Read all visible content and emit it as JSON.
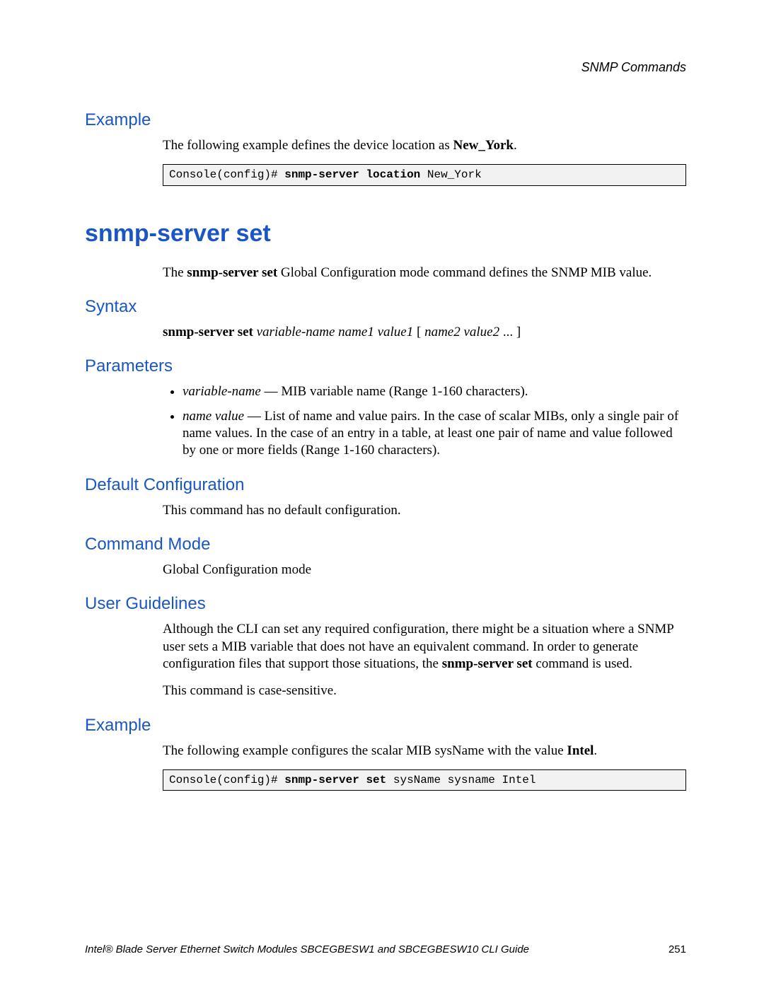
{
  "header": {
    "chapter": "SNMP Commands"
  },
  "sections": {
    "example1": {
      "heading": "Example",
      "intro_pre": "The following example defines the device location as ",
      "intro_bold": "New_York",
      "intro_post": ".",
      "code_prompt": "Console(config)# ",
      "code_bold": "snmp-server location",
      "code_arg": " New_York"
    },
    "command": {
      "title": "snmp-server set",
      "desc_pre": "The ",
      "desc_bold": "snmp-server set",
      "desc_post": " Global Configuration mode command defines the SNMP MIB value."
    },
    "syntax": {
      "heading": "Syntax",
      "bold": "snmp-server set",
      "italic1": " variable-name name1 value1",
      "bracket_open": " [ ",
      "italic2": "name2 value2",
      "tail": " ... ]"
    },
    "parameters": {
      "heading": "Parameters",
      "items": [
        {
          "term": "variable-name",
          "desc": " — MIB variable name (Range 1-160 characters)."
        },
        {
          "term": "name value",
          "desc": " — List of name and value pairs. In the case of scalar MIBs, only a single pair of name values. In the case of an entry in a table, at least one pair of name and value followed by one or more fields (Range 1-160 characters)."
        }
      ]
    },
    "default_config": {
      "heading": "Default Configuration",
      "text": "This command has no default configuration."
    },
    "command_mode": {
      "heading": "Command Mode",
      "text": "Global Configuration mode"
    },
    "user_guidelines": {
      "heading": "User Guidelines",
      "p1_pre": "Although the CLI can set any required configuration, there might be a situation where a SNMP user sets a MIB variable that does not have an equivalent command. In order to generate configuration files that support those situations, the ",
      "p1_bold": "snmp-server set",
      "p1_post": " command is used.",
      "p2": "This command is case-sensitive."
    },
    "example2": {
      "heading": "Example",
      "intro_pre": "The following example configures the scalar MIB sysName with the value ",
      "intro_bold": "Intel",
      "intro_post": ".",
      "code_prompt": "Console(config)# ",
      "code_bold": "snmp-server set",
      "code_arg": " sysName sysname Intel"
    }
  },
  "footer": {
    "title": "Intel® Blade Server Ethernet Switch Modules SBCEGBESW1 and SBCEGBESW10 CLI Guide",
    "page": "251"
  }
}
